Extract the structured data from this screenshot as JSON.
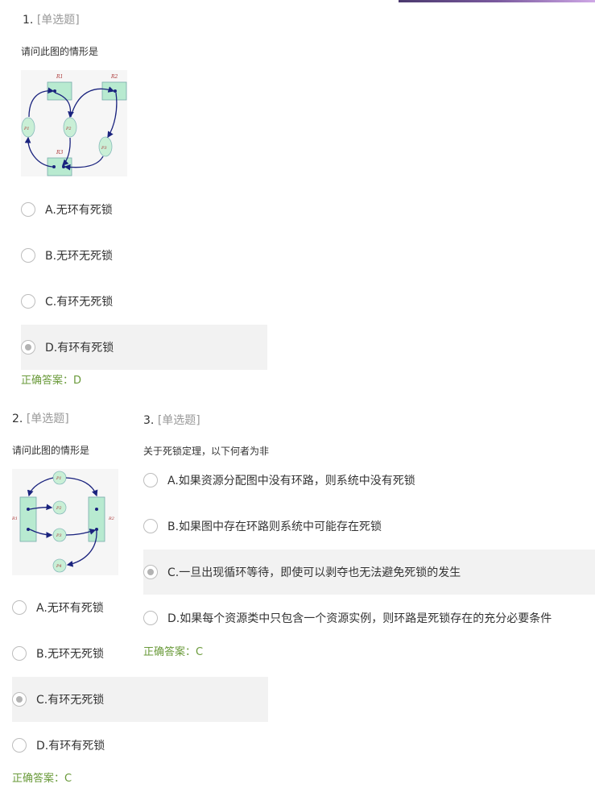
{
  "questions": [
    {
      "number": "1.",
      "type": "[单选题]",
      "stem": "请问此图的情形是",
      "options": [
        "A.无环有死锁",
        "B.无环无死锁",
        "C.有环无死锁",
        "D.有环有死锁"
      ],
      "selected": 3,
      "answer": "正确答案：D",
      "diagram": {
        "resources": [
          "R1",
          "R2",
          "R3"
        ],
        "processes": [
          "P1",
          "P2",
          "P3"
        ]
      }
    },
    {
      "number": "2.",
      "type": "[单选题]",
      "stem": "请问此图的情形是",
      "options": [
        "A.无环有死锁",
        "B.无环无死锁",
        "C.有环无死锁",
        "D.有环有死锁"
      ],
      "selected": 2,
      "answer": "正确答案：C",
      "diagram": {
        "resources": [
          "R1",
          "R2"
        ],
        "processes": [
          "P1",
          "P2",
          "P3",
          "P4"
        ]
      }
    },
    {
      "number": "3.",
      "type": "[单选题]",
      "stem": "关于死锁定理，以下何者为非",
      "options": [
        "A.如果资源分配图中没有环路，则系统中没有死锁",
        "B.如果图中存在环路则系统中可能存在死锁",
        "C.一旦出现循环等待，即使可以剥夺也无法避免死锁的发生",
        "D.如果每个资源类中只包含一个资源实例，则环路是死锁存在的充分必要条件"
      ],
      "selected": 2,
      "answer": "正确答案：C"
    }
  ],
  "colors": {
    "answer": "#6a9a3a",
    "resource_fill": "#b8ead0",
    "process_fill": "#c9efd6",
    "edge": "#1a237e"
  }
}
